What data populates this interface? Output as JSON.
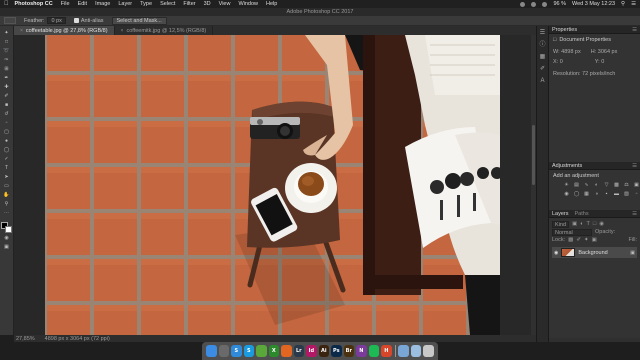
{
  "menubar": {
    "app_name": "Photoshop CC",
    "items": [
      "File",
      "Edit",
      "Image",
      "Layer",
      "Type",
      "Select",
      "Filter",
      "3D",
      "View",
      "Window",
      "Help"
    ],
    "battery": "96 %",
    "clock": "Wed 3 May  12:23"
  },
  "window": {
    "title": "Adobe Photoshop CC 2017"
  },
  "options": {
    "feather_label": "Feather:",
    "feather_value": "0 px",
    "antialias_label": "Anti-alias",
    "select_mask_label": "Select and Mask..."
  },
  "tabs": [
    {
      "label": "coffeetable.jpg @ 27,8% (RGB/8)",
      "active": true
    },
    {
      "label": "coffeemitk.jpg @ 12,5% (RGB/8)",
      "active": false
    }
  ],
  "status": {
    "zoom": "27,85%",
    "doc_info": "4898 px x 3064 px (72 ppi)"
  },
  "properties": {
    "tab_label": "Properties",
    "doc_title": "Document Properties",
    "w_label": "W:",
    "w_value": "4898 px",
    "h_label": "H:",
    "h_value": "3064 px",
    "x_label": "X:",
    "x_value": "0",
    "y_label": "Y:",
    "y_value": "0",
    "resolution": "Resolution: 72 pixels/inch"
  },
  "adjustments": {
    "tab_label": "Adjustments",
    "add_label": "Add an adjustment"
  },
  "layers": {
    "tab_layers": "Layers",
    "tab_paths": "Paths",
    "kind_label": "Kind",
    "blend_mode": "Normal",
    "opacity_label": "Opacity:",
    "lock_label": "Lock:",
    "fill_label": "Fill:",
    "layer_name": "Background"
  },
  "dock": [
    {
      "name": "finder-icon",
      "label": "",
      "color": "#3d8ce4"
    },
    {
      "name": "launchpad-icon",
      "label": "",
      "color": "#6a6a6a"
    },
    {
      "name": "safari-icon",
      "label": "S",
      "color": "#2f8bd9"
    },
    {
      "name": "skype-icon",
      "label": "S",
      "color": "#1a9be0"
    },
    {
      "name": "evernote-icon",
      "label": "",
      "color": "#5aa83a"
    },
    {
      "name": "xbox-icon",
      "label": "X",
      "color": "#2c8a2c"
    },
    {
      "name": "firefox-icon",
      "label": "",
      "color": "#e06622"
    },
    {
      "name": "lightroom-icon",
      "label": "Lr",
      "color": "#2a3a4a"
    },
    {
      "name": "indesign-icon",
      "label": "Id",
      "color": "#b31866"
    },
    {
      "name": "illustrator-icon",
      "label": "Ai",
      "color": "#3a2410"
    },
    {
      "name": "photoshop-icon",
      "label": "Ps",
      "color": "#0b2a4a"
    },
    {
      "name": "bridge-icon",
      "label": "Br",
      "color": "#4a3210"
    },
    {
      "name": "onenote-icon",
      "label": "N",
      "color": "#7a3b9b"
    },
    {
      "name": "spotify-icon",
      "label": "",
      "color": "#1db954"
    },
    {
      "name": "harvest-icon",
      "label": "H",
      "color": "#d6462a"
    },
    {
      "name": "downloads-icon",
      "label": "",
      "color": "#7aa6d6"
    },
    {
      "name": "documents-icon",
      "label": "",
      "color": "#9bbde0"
    },
    {
      "name": "trash-icon",
      "label": "",
      "color": "#c8c8c8"
    }
  ]
}
